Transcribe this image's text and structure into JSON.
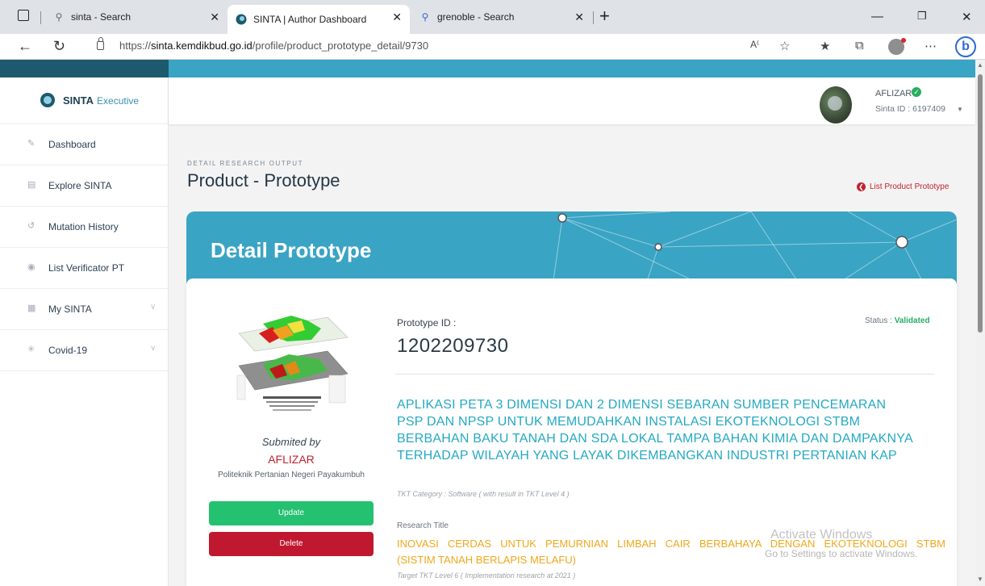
{
  "browser": {
    "tabs": [
      {
        "label": "sinta - Search",
        "icon": "search-icon"
      },
      {
        "label": "SINTA | Author Dashboard",
        "icon": "sinta-logo-icon",
        "active": true
      },
      {
        "label": "grenoble - Search",
        "icon": "search-icon"
      }
    ],
    "url_prefix": "https://",
    "url_host": "sinta.kemdikbud.go.id",
    "url_path": "/profile/product_prototype_detail/9730"
  },
  "sidebar": {
    "brand": "SINTA",
    "brand_sub": "Executive",
    "items": [
      {
        "label": "Dashboard",
        "icon": "pencil-icon"
      },
      {
        "label": "Explore SINTA",
        "icon": "document-icon"
      },
      {
        "label": "Mutation History",
        "icon": "history-icon"
      },
      {
        "label": "List Verificator PT",
        "icon": "user-icon"
      },
      {
        "label": "My SINTA",
        "icon": "grid-icon",
        "expandable": true
      },
      {
        "label": "Covid-19",
        "icon": "virus-icon",
        "expandable": true
      }
    ]
  },
  "user": {
    "name": "AFLIZAR",
    "sinta_id": "Sinta ID : 6197409"
  },
  "page": {
    "kicker": "DETAIL RESEARCH OUTPUT",
    "title": "Product - Prototype",
    "back_link": "List Product Prototype",
    "banner_title": "Detail Prototype"
  },
  "detail": {
    "submitted_by_label": "Submited by",
    "submitter": "AFLIZAR",
    "institution": "Politeknik Pertanian Negeri Payakumbuh",
    "update_label": "Update",
    "delete_label": "Delete",
    "prototype_id_label": "Prototype ID :",
    "prototype_id": "1202209730",
    "status_label": "Status :",
    "status_value": "Validated",
    "title": "APLIKASI PETA 3 DIMENSI DAN 2 DIMENSI SEBARAN SUMBER PENCEMARAN PSP DAN NPSP UNTUK MEMUDAHKAN INSTALASI EKOTEKNOLOGI STBM BERBAHAN BAKU TANAH DAN SDA LOKAL TAMPA BAHAN KIMIA DAN DAMPAKNYA TERHADAP WILAYAH YANG LAYAK DIKEMBANGKAN INDUSTRI PERTANIAN KAP",
    "tkt_category": "TKT Category : Software ( with result in TKT Level 4 )",
    "research_title_label": "Research Title",
    "research_title_line1": "INOVASI CERDAS UNTUK PEMURNIAN LIMBAH CAIR BERBAHAYA DENGAN EKOTEKNOLOGI STBM",
    "research_title_line2": "(SISTIM TANAH BERLAPIS MELAFU)",
    "target_tkt": "Target TKT Level 6 ( Implementation research at 2021 )"
  },
  "watermark": {
    "line1": "Activate Windows",
    "line2": "Go to Settings to activate Windows."
  },
  "colors": {
    "accent": "#3aa4c4",
    "title_teal": "#25a9c4",
    "research_orange": "#f0a81c",
    "danger": "#c0182f",
    "success": "#23c170"
  }
}
